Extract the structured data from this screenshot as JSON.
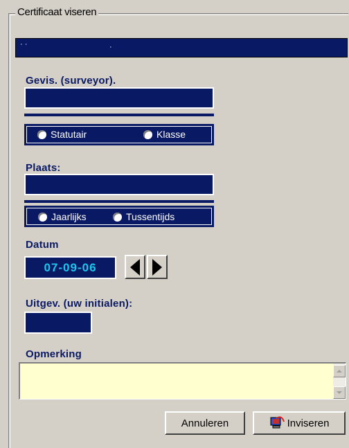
{
  "form": {
    "group_title": "Certificaat viseren",
    "top_bar_text": "· ·",
    "top_bar_dot": "·"
  },
  "surveyor": {
    "label": "Gevis. (surveyor).",
    "value": "",
    "options": [
      "Statutair",
      "Klasse"
    ]
  },
  "place": {
    "label": "Plaats:",
    "value": "",
    "options": [
      "Jaarlijks",
      "Tussentijds"
    ]
  },
  "date": {
    "label": "Datum",
    "value": "07-09-06"
  },
  "initials": {
    "label": "Uitgev. (uw initialen):",
    "value": ""
  },
  "remark": {
    "label": "Opmerking",
    "value": ""
  },
  "buttons": {
    "cancel": "Annuleren",
    "submit": "Inviseren"
  },
  "colors": {
    "navy": "#0a1963",
    "panel": "#d4d0c8",
    "remark_bg": "#ffffd0",
    "date_text": "#19c8f0"
  }
}
